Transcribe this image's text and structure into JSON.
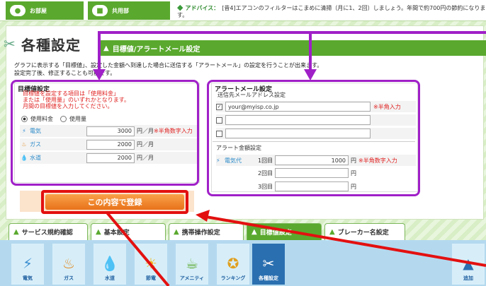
{
  "topbar": {
    "tab1": "お部屋",
    "tab2": "共用部",
    "advice_label": "アドバイス：",
    "advice_text": "[昔4]エアコンのフィルターはこまめに清掃（月に1、2回）しましょう。年間で約700円の節約になります。"
  },
  "page_title": "各種設定",
  "section_header": "目標値/アラートメール設定",
  "desc_line1": "グラフに表示する「目標値」、設定した金額へ到達した場合に送信する「アラートメール」の設定を行うことが出来ます。",
  "desc_line2": "設定完了後、修正することも可能です。",
  "target": {
    "title": "目標値設定",
    "note1": "目標値を設定する項目は「使用料金」",
    "note2": "または「使用量」のいずれかとなります。",
    "note3": "月間の目標値を入力してください。",
    "radio1": "使用料金",
    "radio2": "使用量",
    "rows": [
      {
        "name": "電気",
        "value": "3000",
        "unit": "円／月",
        "hint": "※半角数字入力"
      },
      {
        "name": "ガス",
        "value": "2000",
        "unit": "円／月"
      },
      {
        "name": "水道",
        "value": "2000",
        "unit": "円／月"
      }
    ]
  },
  "alert": {
    "title": "アラートメール設定",
    "sub": "送信先メールアドレス設定",
    "email1": "your@myisp.co.jp",
    "email_hint": "※半角入力",
    "amount_title": "アラート金額設定",
    "electric_label": "電気代",
    "rows": [
      {
        "label": "1回目",
        "value": "1000",
        "unit": "円",
        "hint": "※半角数字入力"
      },
      {
        "label": "2回目",
        "value": "",
        "unit": "円"
      },
      {
        "label": "3回目",
        "value": "",
        "unit": "円"
      }
    ]
  },
  "register_button": "この内容で登録",
  "tabs": [
    "サービス規約確認",
    "基本設定",
    "携帯操作設定",
    "目標値設定",
    "ブレーカー名設定"
  ],
  "icons": [
    {
      "label": "電気"
    },
    {
      "label": "ガス"
    },
    {
      "label": "水道"
    },
    {
      "label": "節電"
    },
    {
      "label": "アメニティ"
    },
    {
      "label": "ランキング"
    },
    {
      "label": "各種設定"
    },
    {
      "label": "追加"
    }
  ]
}
